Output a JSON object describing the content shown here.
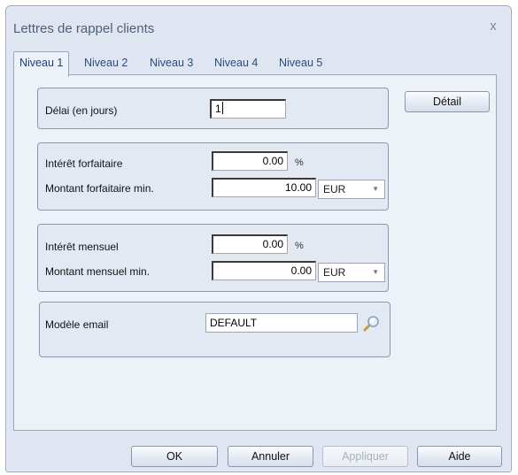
{
  "window": {
    "title": "Lettres de rappel clients",
    "close_glyph": "x"
  },
  "tabs": [
    {
      "label": "Niveau 1",
      "active": true
    },
    {
      "label": "Niveau 2",
      "active": false
    },
    {
      "label": "Niveau 3",
      "active": false
    },
    {
      "label": "Niveau 4",
      "active": false
    },
    {
      "label": "Niveau 5",
      "active": false
    }
  ],
  "delay": {
    "label": "Délai (en jours)",
    "value": "1"
  },
  "detail_button": "Détail",
  "flat": {
    "interest_label": "Intérêt forfaitaire",
    "interest_value": "0.00",
    "percent_sign": "%",
    "min_label": "Montant forfaitaire min.",
    "min_value": "10.00",
    "currency": "EUR"
  },
  "monthly": {
    "interest_label": "Intérêt mensuel",
    "interest_value": "0.00",
    "percent_sign": "%",
    "min_label": "Montant mensuel min.",
    "min_value": "0.00",
    "currency": "EUR"
  },
  "email": {
    "label": "Modèle email",
    "value": "DEFAULT",
    "lookup_icon": "magnifier-icon"
  },
  "buttons": {
    "ok": "OK",
    "cancel": "Annuler",
    "apply": "Appliquer",
    "help": "Aide"
  },
  "colors": {
    "window_bg": "#dfe6f1",
    "tab_text": "#2a4b80",
    "border": "#9aa8bd"
  }
}
